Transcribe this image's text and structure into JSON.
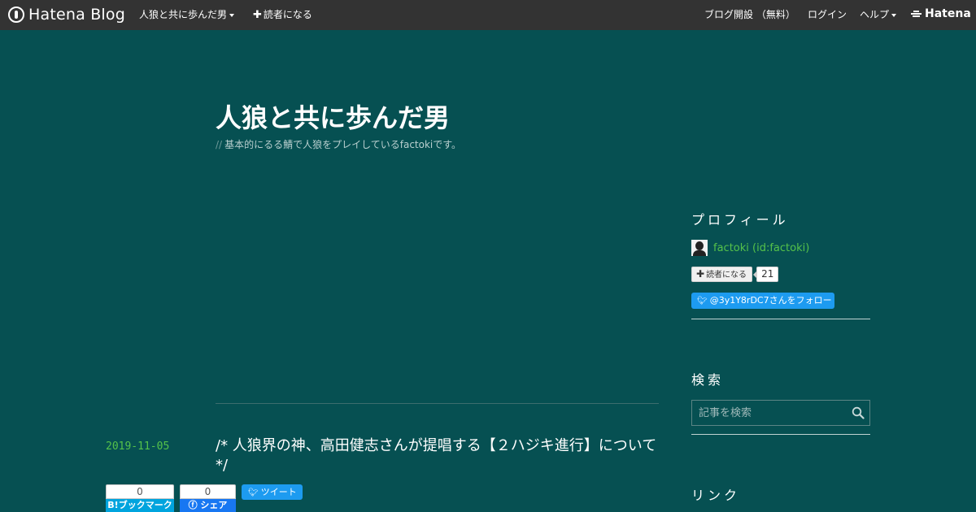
{
  "globalbar": {
    "logo_text": "Hatena Blog",
    "blog_menu": "人狼と共に歩んだ男",
    "subscribe": "読者になる",
    "open_blog": "ブログ開設 （無料）",
    "login": "ログイン",
    "help": "ヘルプ",
    "hatena": "Hatena"
  },
  "header": {
    "title": "人狼と共に歩んだ男",
    "description_prefix": "//",
    "description": "基本的にるる鯖で人狼をプレイしているfactokiです。"
  },
  "entry": {
    "date": "2019-11-05",
    "title": "/*  人狼界の神、高田健志さんが提唱する【２ハジキ進行】について　*/",
    "hatebu_count": "0",
    "hatebu_label": "B!ブックマーク",
    "facebook_count": "0",
    "facebook_label": "シェア",
    "tweet_label": "ツイート"
  },
  "sidebar": {
    "profile_heading": "プロフィール",
    "profile_name": "factoki (id:factoki)",
    "subscribe_label": "読者になる",
    "subscriber_count": "21",
    "follow_label": "@3y1Y8rDC7さんをフォロー",
    "search_heading": "検索",
    "search_placeholder": "記事を検索",
    "links_heading": "リンク"
  },
  "colors": {
    "background": "#065052",
    "globalbar": "#333333",
    "accent_green": "#55c24a",
    "twitter_blue": "#1d9bf0"
  }
}
